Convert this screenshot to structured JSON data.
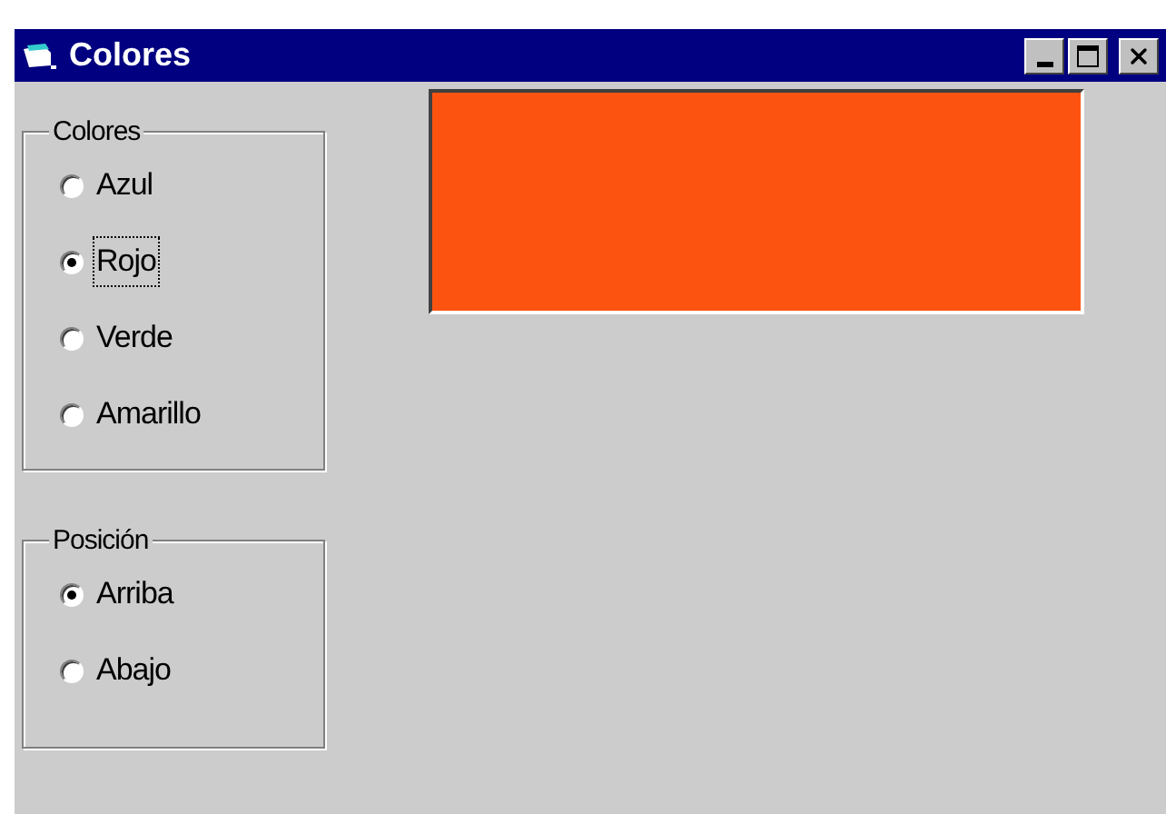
{
  "window": {
    "title": "Colores"
  },
  "groups": [
    {
      "title": "Colores",
      "options": [
        {
          "label": "Azul",
          "selected": false,
          "focused": false
        },
        {
          "label": "Rojo",
          "selected": true,
          "focused": true
        },
        {
          "label": "Verde",
          "selected": false,
          "focused": false
        },
        {
          "label": "Amarillo",
          "selected": false,
          "focused": false
        }
      ]
    },
    {
      "title": "Posición",
      "options": [
        {
          "label": "Arriba",
          "selected": true,
          "focused": false
        },
        {
          "label": "Abajo",
          "selected": false,
          "focused": false
        }
      ]
    }
  ],
  "preview": {
    "color": "#fc5410"
  }
}
